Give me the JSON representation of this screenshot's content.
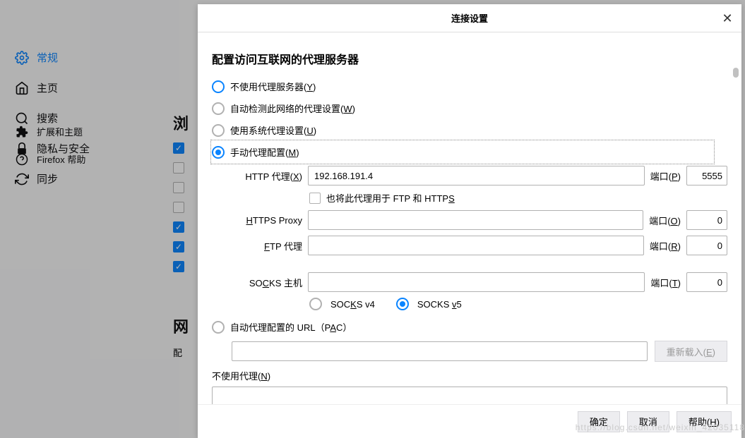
{
  "sidebar": {
    "items": [
      {
        "icon": "gear",
        "label": "常规",
        "active": true
      },
      {
        "icon": "home",
        "label": "主页"
      },
      {
        "icon": "search",
        "label": "搜索"
      },
      {
        "icon": "lock",
        "label": "隐私与安全"
      },
      {
        "icon": "sync",
        "label": "同步"
      }
    ],
    "bottom": [
      {
        "icon": "puzzle",
        "label": "扩展和主题"
      },
      {
        "icon": "help",
        "label": "Firefox 帮助"
      }
    ]
  },
  "bg": {
    "heading1": "浏",
    "heading2": "网",
    "line": "配",
    "checks": [
      true,
      false,
      false,
      false,
      true,
      true,
      true
    ]
  },
  "dialog": {
    "title": "连接设置",
    "section_title": "配置访问互联网的代理服务器",
    "radios": {
      "none": "不使用代理服务器(Y)",
      "auto": "自动检测此网络的代理设置(W)",
      "system": "使用系统代理设置(U)",
      "manual": "手动代理配置(M)",
      "pac": "自动代理配置的 URL（PAC）"
    },
    "fields": {
      "http_label": "HTTP 代理(X)",
      "http_value": "192.168.191.4",
      "http_port_label": "端口(P)",
      "http_port_value": "5555",
      "share_label": "也将此代理用于 FTP 和 HTTPS",
      "https_label": "HTTPS Proxy",
      "https_value": "",
      "https_port_label": "端口(O)",
      "https_port_value": "0",
      "ftp_label": "FTP 代理",
      "ftp_value": "",
      "ftp_port_label": "端口(R)",
      "ftp_port_value": "0",
      "socks_label": "SOCKS 主机",
      "socks_value": "",
      "socks_port_label": "端口(T)",
      "socks_port_value": "0",
      "socks_v4": "SOCKS v4",
      "socks_v5": "SOCKS v5",
      "pac_value": "",
      "reload_btn": "重新载入(E)",
      "noproxy_label": "不使用代理(N)"
    },
    "buttons": {
      "ok": "确定",
      "cancel": "取消",
      "help": "帮助(H)"
    }
  },
  "watermark": "https://blog.csdn.net/weixin_42035118"
}
